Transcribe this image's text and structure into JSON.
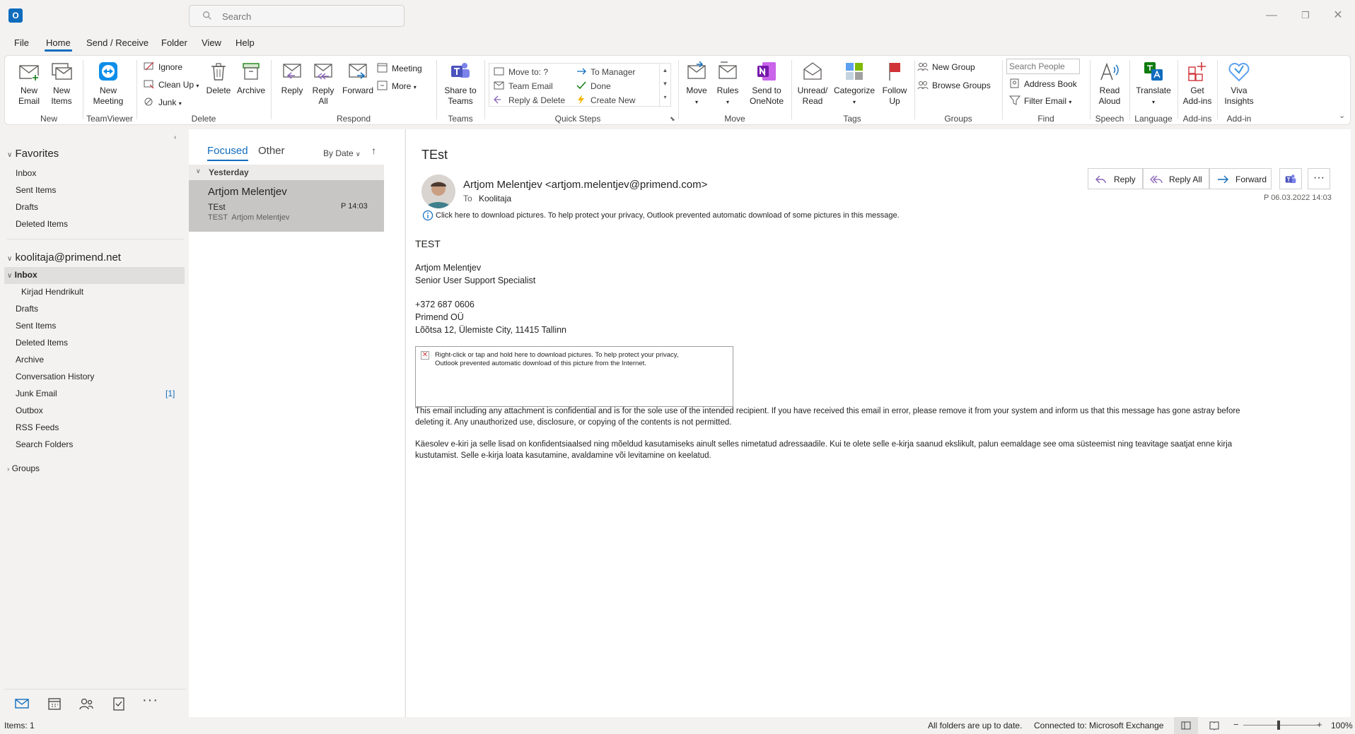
{
  "title_bar": {
    "app_icon": "outlook-icon",
    "search_placeholder": "Search"
  },
  "menu": {
    "tabs": [
      "File",
      "Home",
      "Send / Receive",
      "Folder",
      "View",
      "Help"
    ],
    "active": "Home"
  },
  "ribbon": {
    "new": {
      "new_email": "New Email",
      "new_items": "New Items",
      "group": "New"
    },
    "teamviewer": {
      "new_meeting": "New Meeting",
      "group": "TeamViewer"
    },
    "delete": {
      "ignore": "Ignore",
      "clean_up": "Clean Up",
      "junk": "Junk",
      "delete": "Delete",
      "archive": "Archive",
      "group": "Delete"
    },
    "respond": {
      "reply": "Reply",
      "reply_all": "Reply All",
      "forward": "Forward",
      "meeting": "Meeting",
      "more": "More",
      "group": "Respond"
    },
    "teams": {
      "share": "Share to Teams",
      "group": "Teams"
    },
    "quick_steps": {
      "items": [
        "Move to: ?",
        "Team Email",
        "Reply & Delete",
        "To Manager",
        "Done",
        "Create New"
      ],
      "group": "Quick Steps"
    },
    "move": {
      "move": "Move",
      "rules": "Rules",
      "onenote": "Send to OneNote",
      "group": "Move"
    },
    "tags": {
      "unread": "Unread/ Read",
      "categorize": "Categorize",
      "follow_up": "Follow Up",
      "group": "Tags"
    },
    "groups": {
      "new_group": "New Group",
      "browse_groups": "Browse Groups",
      "group": "Groups"
    },
    "find": {
      "search_people": "Search People",
      "address_book": "Address Book",
      "filter_email": "Filter Email",
      "group": "Find"
    },
    "speech": {
      "read_aloud": "Read Aloud",
      "group": "Speech"
    },
    "language": {
      "translate": "Translate",
      "group": "Language"
    },
    "addins": {
      "get_addins": "Get Add-ins",
      "group": "Add-ins"
    },
    "addin": {
      "viva": "Viva Insights",
      "group": "Add-in"
    }
  },
  "nav": {
    "favorites_label": "Favorites",
    "favorites": [
      "Inbox",
      "Sent Items",
      "Drafts",
      "Deleted Items"
    ],
    "account": "koolitaja@primend.net",
    "inbox": "Inbox",
    "inbox_sub": "Kirjad Hendrikult",
    "folders": [
      "Drafts",
      "Sent Items",
      "Deleted Items",
      "Archive",
      "Conversation History",
      "Junk Email",
      "Outbox",
      "RSS Feeds",
      "Search Folders"
    ],
    "junk_count": "[1]",
    "groups": "Groups"
  },
  "message_list": {
    "tab_focused": "Focused",
    "tab_other": "Other",
    "sort": "By Date",
    "group_header": "Yesterday",
    "message": {
      "sender": "Artjom Melentjev",
      "subject": "TEst",
      "time": "P 14:03",
      "preview": "TEST  Artjom Melentjev"
    }
  },
  "reading_pane": {
    "subject": "TEst",
    "from": "Artjom Melentjev <artjom.melentjev@primend.com>",
    "to_label": "To",
    "to": "Koolitaja",
    "info_bar": "Click here to download pictures. To help protect your privacy, Outlook prevented automatic download of some pictures in this message.",
    "date": "P 06.03.2022 14:03",
    "buttons": {
      "reply": "Reply",
      "reply_all": "Reply All",
      "forward": "Forward"
    },
    "body": {
      "line1": "TEST",
      "sig_name": "Artjom Melentjev",
      "sig_title": "Senior User Support Specialist",
      "phone": "+372 687 0606",
      "company": "Primend OÜ",
      "address": "Lõõtsa 12, Ülemiste City, 11415 Tallinn",
      "blocked_image_line1": "Right-click or tap and hold here to download pictures. To help protect your privacy,",
      "blocked_image_line2": "Outlook prevented automatic download of this picture from the Internet.",
      "disclaimer_en_1": "This email including any attachment is confidential and is for the sole use of the intended recipient. If you have received this email in error, please remove it from your system and inform us that this message has gone astray before",
      "disclaimer_en_2": "deleting it. Any unauthorized use, disclosure, or copying of the contents is not permitted.",
      "disclaimer_et_1": "Käesolev e-kiri ja selle lisad on konfidentsiaalsed ning mõeldud kasutamiseks ainult selles nimetatud adressaadile. Kui te olete selle e-kirja saanud ekslikult, palun eemaldage see oma süsteemist ning teavitage saatjat enne kirja",
      "disclaimer_et_2": "kustutamist. Selle e-kirja loata kasutamine, avaldamine või levitamine on keelatud."
    }
  },
  "status_bar": {
    "items": "Items: 1",
    "sync": "All folders are up to date.",
    "connection": "Connected to: Microsoft Exchange",
    "zoom": "100%"
  },
  "colors": {
    "accent": "#0f6cbd",
    "selected_row": "#c8c6c4"
  }
}
